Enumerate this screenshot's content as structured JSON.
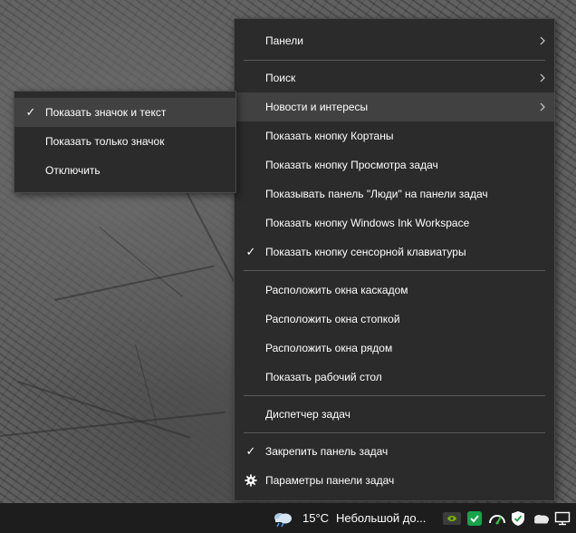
{
  "main_menu": {
    "items": [
      {
        "label": "Панели",
        "has_submenu": true
      },
      {
        "label": "Поиск",
        "has_submenu": true
      },
      {
        "label": "Новости и интересы",
        "has_submenu": true
      },
      {
        "label": "Показать кнопку Кортаны"
      },
      {
        "label": "Показать кнопку Просмотра задач"
      },
      {
        "label": "Показывать панель \"Люди\" на панели задач"
      },
      {
        "label": "Показать кнопку Windows Ink Workspace"
      },
      {
        "label": "Показать кнопку сенсорной клавиатуры",
        "checked": true
      },
      {
        "label": "Расположить окна каскадом"
      },
      {
        "label": "Расположить окна стопкой"
      },
      {
        "label": "Расположить окна рядом"
      },
      {
        "label": "Показать рабочий стол"
      },
      {
        "label": "Диспетчер задач"
      },
      {
        "label": "Закрепить панель задач",
        "checked": true
      },
      {
        "label": "Параметры панели задач"
      }
    ]
  },
  "sub_menu": {
    "items": [
      {
        "label": "Показать значок и текст",
        "checked": true
      },
      {
        "label": "Показать только значок"
      },
      {
        "label": "Отключить"
      }
    ]
  },
  "taskbar": {
    "weather_temp": "15°C",
    "weather_text": "Небольшой до...",
    "icons": [
      "weather-cloud-icon",
      "nvidia-icon",
      "security-check-icon",
      "network-speed-icon",
      "shield-icon",
      "onedrive-icon",
      "monitor-icon"
    ]
  },
  "colors": {
    "menu_bg": "#2b2b2b",
    "menu_hover": "#414141",
    "separator": "#5a5a5a",
    "taskbar_bg": "#1d1d1d"
  }
}
